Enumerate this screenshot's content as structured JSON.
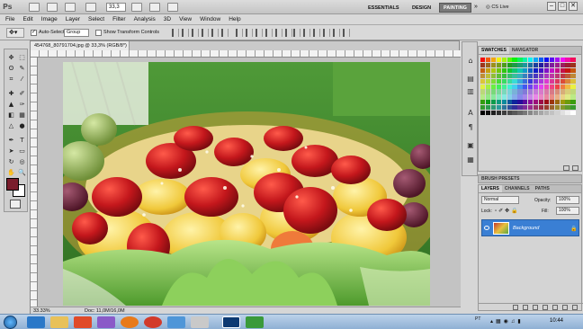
{
  "app": {
    "logo": "Ps",
    "zoom_value": "33,3",
    "workspaces": [
      "ESSENTIALS",
      "DESIGN",
      "PAINTING"
    ],
    "active_workspace": "PAINTING",
    "cs_live": "CS Live",
    "window_buttons": [
      "–",
      "□",
      "✕"
    ]
  },
  "menu": [
    "File",
    "Edit",
    "Image",
    "Layer",
    "Select",
    "Filter",
    "Analysis",
    "3D",
    "View",
    "Window",
    "Help"
  ],
  "options": {
    "auto_select_label": "Auto-Select:",
    "auto_select_value": "Group",
    "transform_label": "Show Transform Controls"
  },
  "document": {
    "tab_title": "454768_80791704.jpg @ 33,3% (RGB/8*)",
    "zoom_status": "33.33%",
    "doc_info": "Doc: 11,0M/16,0M"
  },
  "colors": {
    "foreground": "#7a1d2c",
    "background": "#ffffff",
    "active_layer": "#3a7fd4"
  },
  "panels": {
    "swatches_tabs": [
      "SWATCHES",
      "NAVIGATOR"
    ],
    "brush_presets": "BRUSH PRESETS",
    "layers_tabs": [
      "LAYERS",
      "CHANNELS",
      "PATHS"
    ],
    "blend_mode": "Normal",
    "opacity_label": "Opacity:",
    "opacity_value": "100%",
    "lock_label": "Lock:",
    "fill_label": "Fill:",
    "fill_value": "100%",
    "layer_name": "Background"
  },
  "taskbar": {
    "lang": "PT",
    "time": "10:44"
  }
}
